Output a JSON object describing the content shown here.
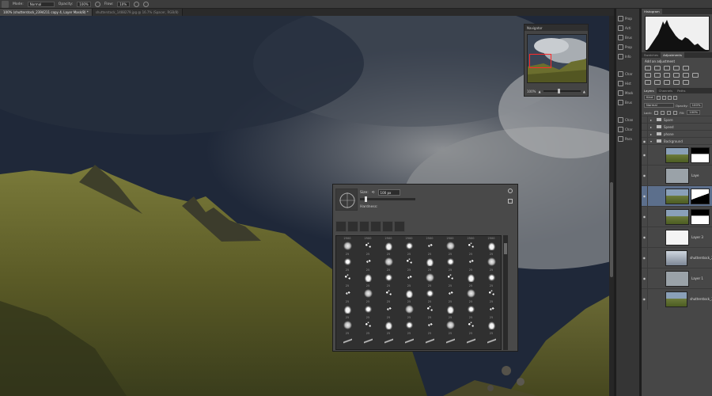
{
  "options_bar": {
    "mode_label": "Mode:",
    "mode_value": "Normal",
    "opacity_label": "Opacity:",
    "opacity_value": "100%",
    "flow_label": "Flow:",
    "flow_value": "10%"
  },
  "doc_tabs": [
    {
      "label": "100% (shutterstock_2394211 copy 4, Layer Mask/8) *",
      "active": true
    },
    {
      "label": "shutterstock_1488279.jpg @ 16.7% (Spacer, RGB/8)",
      "active": false
    }
  ],
  "navigator": {
    "title": "Navigator",
    "zoom": "100%"
  },
  "brush_picker": {
    "size_label": "Size:",
    "size_value": "100 px",
    "hardness_label": "Hardness:",
    "preset_sizes": [
      "2500",
      "2500",
      "2500",
      "2500",
      "2500",
      "2500",
      "2500",
      "2500",
      "25",
      "25",
      "25",
      "25",
      "25",
      "25",
      "25",
      "25",
      "25",
      "25",
      "25",
      "25",
      "25",
      "25",
      "25",
      "25",
      "25",
      "25",
      "25",
      "25",
      "25",
      "25",
      "25",
      "25",
      "25",
      "25",
      "25",
      "25",
      "25",
      "25",
      "25",
      "25",
      "25",
      "25",
      "25",
      "25",
      "25",
      "25",
      "25",
      "25",
      "25",
      "25",
      "25",
      "25",
      "25",
      "25",
      "25",
      "25"
    ]
  },
  "side_icons": [
    {
      "label": "Prop",
      "icon": "properties-icon"
    },
    {
      "label": "Acti",
      "icon": "actions-icon"
    },
    {
      "label": "Brus",
      "icon": "brush-icon"
    },
    {
      "label": "Prop",
      "icon": "preset-icon"
    },
    {
      "label": "Info",
      "icon": "info-icon"
    },
    {
      "label": "Char",
      "icon": "character-icon"
    },
    {
      "label": "Hist",
      "icon": "history-icon"
    },
    {
      "label": "Mask",
      "icon": "mask-icon"
    },
    {
      "label": "Brus",
      "icon": "brush-presets-icon"
    },
    {
      "label": "Chan",
      "icon": "channels-icon"
    },
    {
      "label": "Char",
      "icon": "character-styles-icon"
    },
    {
      "label": "Para",
      "icon": "paragraph-icon"
    }
  ],
  "histogram_tab": "Histogram",
  "adjust_tabs": [
    "Swatches",
    "Adjustments"
  ],
  "adjust_title": "Add an adjustment",
  "layers_tabs": [
    "Layers",
    "Channels",
    "Paths"
  ],
  "layers": {
    "kind_label": "Kind",
    "blend_mode": "Normal",
    "opacity_label": "Opacity:",
    "opacity_value": "100%",
    "lock_label": "Lock:",
    "fill_label": "Fill:",
    "fill_value": "100%",
    "groups": [
      "Spare",
      "Speed",
      "phone",
      "Background"
    ],
    "rows": [
      {
        "name": "",
        "thumb": "photo",
        "mask": "m1",
        "selected": false
      },
      {
        "name": "Laye",
        "thumb": "grey",
        "mask": "none",
        "selected": false
      },
      {
        "name": "",
        "thumb": "photo",
        "mask": "m2",
        "selected": true
      },
      {
        "name": "",
        "thumb": "photo",
        "mask": "m1",
        "selected": false
      },
      {
        "name": "Layer 3",
        "thumb": "white",
        "mask": "none",
        "selected": false
      },
      {
        "name": "shutterstock_2",
        "thumb": "sky",
        "mask": "none",
        "selected": false
      },
      {
        "name": "Layer 1",
        "thumb": "grey",
        "mask": "none",
        "selected": false
      },
      {
        "name": "shutterstock_3",
        "thumb": "photo",
        "mask": "none",
        "selected": false
      }
    ]
  }
}
